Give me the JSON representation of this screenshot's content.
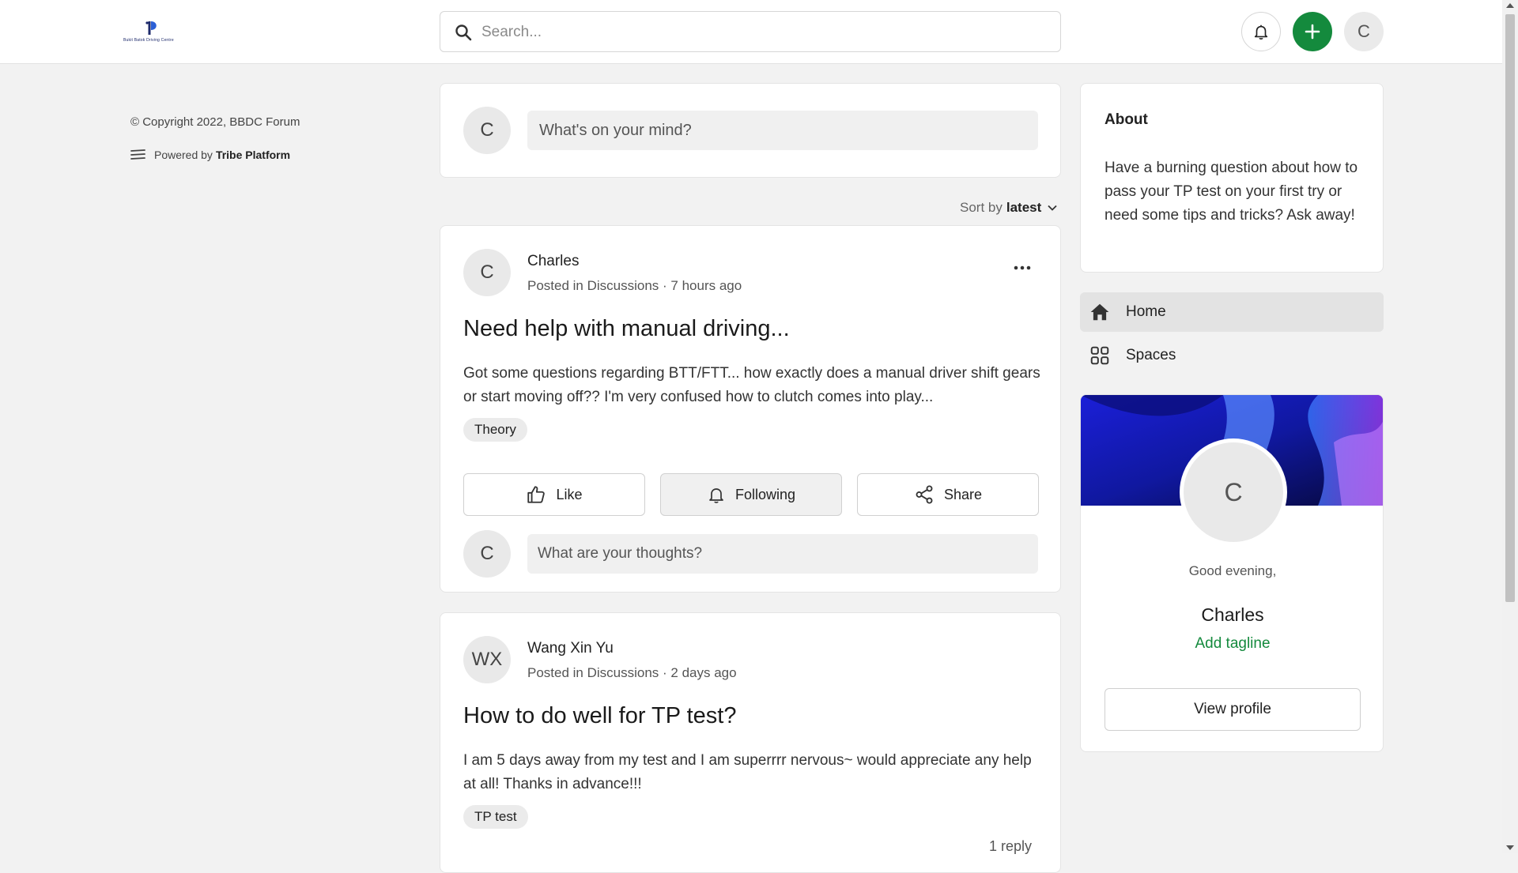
{
  "brand": {
    "logo_text": "Bukit Batok Driving Centre"
  },
  "header": {
    "search_placeholder": "Search...",
    "user_initial": "C",
    "accent_color": "#148a3d"
  },
  "footer": {
    "copyright": "© Copyright 2022, BBDC Forum",
    "powered_prefix": "Powered by",
    "powered_brand": "Tribe Platform"
  },
  "composer": {
    "avatar": "C",
    "placeholder": "What's on your mind?"
  },
  "sort": {
    "label": "Sort by",
    "value": "latest"
  },
  "posts": [
    {
      "avatar": "C",
      "author": "Charles",
      "meta": "Posted in Discussions · 7 hours ago",
      "title": "Need help with manual driving...",
      "body": "Got some questions regarding BTT/FTT... how exactly does a manual driver shift gears or start moving off?? I'm very confused how to clutch comes into play...",
      "tag": "Theory",
      "actions": {
        "like": "Like",
        "following": "Following",
        "share": "Share"
      },
      "comment_avatar": "C",
      "comment_placeholder": "What are your thoughts?"
    },
    {
      "avatar": "WX",
      "author": "Wang Xin Yu",
      "meta": "Posted in Discussions · 2 days ago",
      "title": "How to do well for TP test?",
      "body": "I am 5 days away from my test and I am superrrr nervous~ would appreciate any help at all! Thanks in advance!!!",
      "tag": "TP test",
      "replies": "1 reply"
    }
  ],
  "about": {
    "heading": "About",
    "text": "Have a burning question about how to pass your TP test on your first try or need some tips and tricks? Ask away!"
  },
  "nav": {
    "home": "Home",
    "spaces": "Spaces"
  },
  "profile": {
    "avatar": "C",
    "greeting": "Good evening,",
    "name": "Charles",
    "tagline_link": "Add tagline",
    "view_button": "View profile"
  }
}
